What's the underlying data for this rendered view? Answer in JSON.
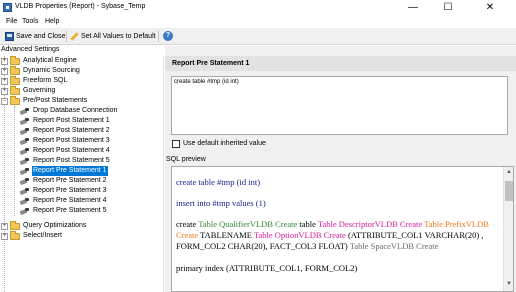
{
  "window": {
    "title": "VLDB Properties (Report) - Sybase_Temp",
    "minimize": "—",
    "maximize": "☐",
    "close": "✕"
  },
  "menu": {
    "items": [
      "File",
      "Tools",
      "Help"
    ]
  },
  "toolbar": {
    "save_label": "Save and Close",
    "set_all_label": "Set All Values to Default",
    "help": "?"
  },
  "tree": {
    "root_label": "Advanced Settings",
    "items": [
      {
        "label": "Analytical Engine",
        "type": "folder",
        "expander": "+"
      },
      {
        "label": "Dynamic Sourcing",
        "type": "folder",
        "expander": "+"
      },
      {
        "label": "Freeform SQL",
        "type": "folder",
        "expander": "+"
      },
      {
        "label": "Governing",
        "type": "folder",
        "expander": "+"
      },
      {
        "label": "Pre/Post Statements",
        "type": "folder",
        "expander": "−"
      },
      {
        "label": "Drop Database Connection",
        "type": "setting"
      },
      {
        "label": "Report Post Statement 1",
        "type": "setting"
      },
      {
        "label": "Report Post Statement 2",
        "type": "setting"
      },
      {
        "label": "Report Post Statement 3",
        "type": "setting"
      },
      {
        "label": "Report Post Statement 4",
        "type": "setting"
      },
      {
        "label": "Report Post Statement 5",
        "type": "setting"
      },
      {
        "label": "Report Pre Statement 1",
        "type": "setting",
        "selected": true
      },
      {
        "label": "Report Pre Statement 2",
        "type": "setting"
      },
      {
        "label": "Report Pre Statement 3",
        "type": "setting"
      },
      {
        "label": "Report Pre Statement 4",
        "type": "setting"
      },
      {
        "label": "Report Pre Statement 5",
        "type": "setting"
      },
      {
        "label": "Query Optimizations",
        "type": "folder",
        "expander": "+"
      },
      {
        "label": "Select/Insert",
        "type": "folder",
        "expander": "+"
      }
    ]
  },
  "detail": {
    "title": "Report Pre Statement 1",
    "editor_value": "create table #tmp (id int)",
    "checkbox_label": "Use default inherited value",
    "checkbox_checked": false,
    "preview_label": "SQL preview",
    "preview": {
      "line1": "create table #tmp (id int)",
      "line2": "insert into #tmp values (1)",
      "line3": {
        "p1": "create ",
        "p2": "Table Qualifier",
        "p3": "VLDB Create",
        "p4": " table ",
        "p5": "Table Descriptor",
        "p6": "VLDB Create",
        "p7": " Table Prefix",
        "p8": "VLDB"
      },
      "line4": {
        "p1": "Create",
        "p2": " TABLENAME ",
        "p3": "Table Option",
        "p4": "VLDB Create",
        "p5": " (ATTRIBUTE_COL1 VARCHAR(20) ,"
      },
      "line5": {
        "p1": "FORM_COL2 CHAR(20), FACT_COL3 FLOAT)",
        "p2": " Table Space",
        "p3": "VLDB Create"
      },
      "line6": "primary index (ATTRIBUTE_COL1, FORM_COL2)"
    }
  },
  "colors": {
    "selection": "#0078d7",
    "kw_green": "#2e8b2e",
    "kw_magenta": "#d91a9b",
    "kw_orange": "#f0781e",
    "sql_blue": "#1a1a8c"
  }
}
